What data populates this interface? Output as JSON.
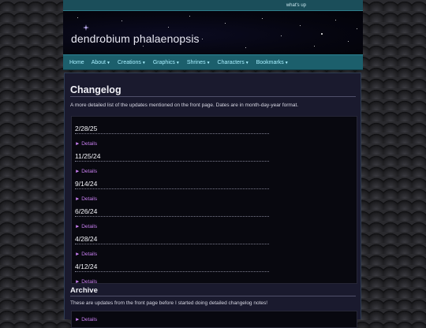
{
  "topbar": {
    "link": "what's up"
  },
  "header": {
    "title": "dendrobium phalaenopsis"
  },
  "nav": {
    "items": [
      {
        "label": "Home",
        "dropdown": false
      },
      {
        "label": "About",
        "dropdown": true
      },
      {
        "label": "Creations",
        "dropdown": true
      },
      {
        "label": "Graphics",
        "dropdown": true
      },
      {
        "label": "Shrines",
        "dropdown": true
      },
      {
        "label": "Characters",
        "dropdown": true
      },
      {
        "label": "Bookmarks",
        "dropdown": true
      }
    ],
    "caret_icon": "caret-down-icon"
  },
  "changelog": {
    "title": "Changelog",
    "intro": "A more detailed list of the updates mentioned on the front page. Dates are in month-day-year format.",
    "details_label": "► Details",
    "entries": [
      {
        "date": "2/28/25"
      },
      {
        "date": "11/25/24"
      },
      {
        "date": "9/14/24"
      },
      {
        "date": "6/26/24"
      },
      {
        "date": "4/28/24"
      },
      {
        "date": "4/12/24"
      }
    ]
  },
  "archive": {
    "title": "Archive",
    "description": "These are updates from the front page before I started doing detailed changelog notes!",
    "details_label": "► Details"
  },
  "colors": {
    "nav_bg": "#1c5f6c",
    "nav_text": "#a8f0ff",
    "link_purple": "#c87ff0",
    "content_bg": "#1a1a2e"
  }
}
